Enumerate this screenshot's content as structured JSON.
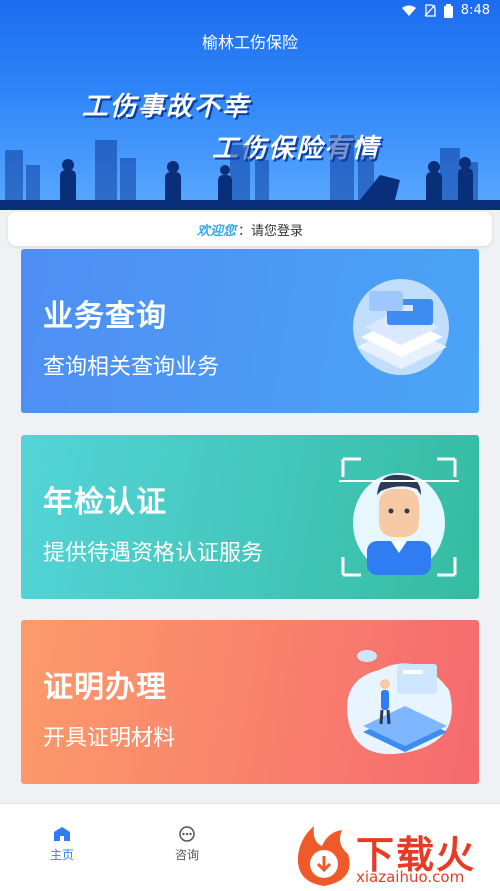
{
  "status_bar": {
    "time": "8:48"
  },
  "header": {
    "title": "榆林工伤保险",
    "slogan_line1": "工伤事故不幸",
    "slogan_line2": "工伤保险有情"
  },
  "welcome": {
    "greeting": "欢迎您",
    "message": "：请您登录"
  },
  "cards": [
    {
      "title": "业务查询",
      "subtitle": "查询相关查询业务"
    },
    {
      "title": "年检认证",
      "subtitle": "提供待遇资格认证服务"
    },
    {
      "title": "证明办理",
      "subtitle": "开具证明材料"
    }
  ],
  "tabbar": {
    "items": [
      {
        "label": "主页"
      },
      {
        "label": "咨询"
      }
    ]
  },
  "watermark": {
    "text": "下载火",
    "url": "xiazaihuo.com"
  },
  "colors": {
    "primary": "#2f7cf3",
    "card1": "#4f8ef3",
    "card2": "#36bba2",
    "card3": "#f56a6e"
  }
}
